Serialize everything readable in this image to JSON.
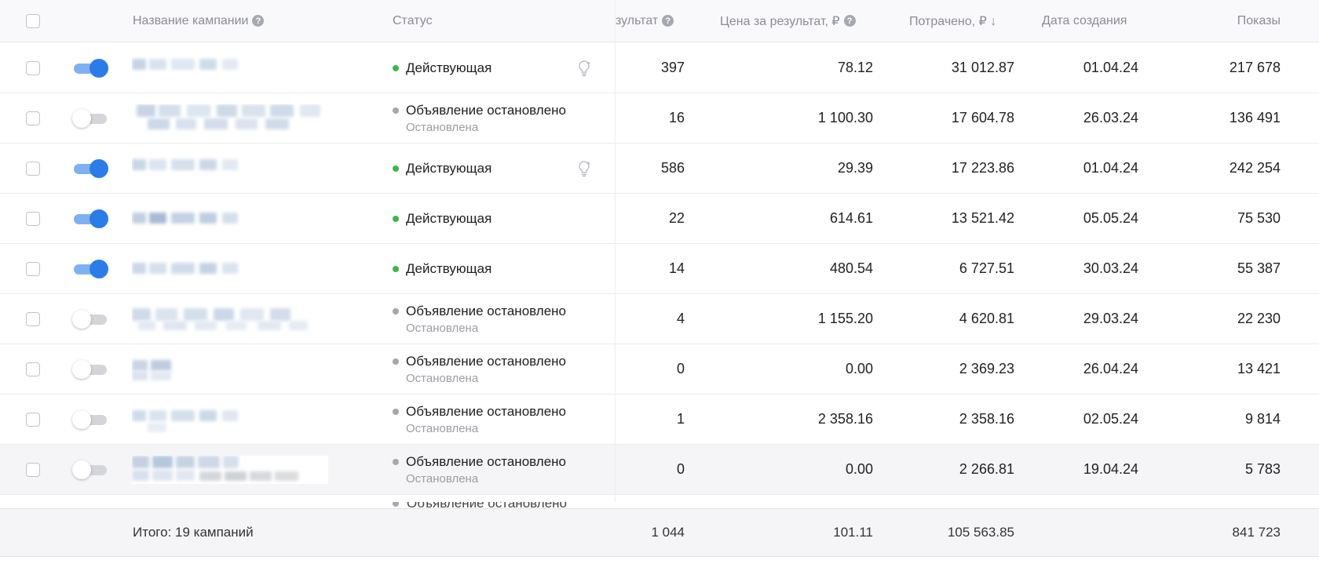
{
  "header": {
    "name_label": "Название кампании",
    "name_help": "?",
    "status_label": "Статус",
    "result_label": "зультат",
    "result_help": "?",
    "cpr_label": "Цена за результат, ₽",
    "cpr_help": "?",
    "spent_label": "Потрачено, ₽ ↓",
    "created_label": "Дата создания",
    "impressions_label": "Показы"
  },
  "rows": [
    {
      "on": true,
      "status": "Действующая",
      "status_color": "green",
      "sub": "",
      "bulb": true,
      "result": "397",
      "cpr": "78.12",
      "spent": "31 012.87",
      "created": "01.04.24",
      "impressions": "217 678"
    },
    {
      "on": false,
      "status": "Объявление остановлено",
      "status_color": "grey",
      "sub": "Остановлена",
      "bulb": false,
      "result": "16",
      "cpr": "1 100.30",
      "spent": "17 604.78",
      "created": "26.03.24",
      "impressions": "136 491"
    },
    {
      "on": true,
      "status": "Действующая",
      "status_color": "green",
      "sub": "",
      "bulb": true,
      "result": "586",
      "cpr": "29.39",
      "spent": "17 223.86",
      "created": "01.04.24",
      "impressions": "242 254"
    },
    {
      "on": true,
      "status": "Действующая",
      "status_color": "green",
      "sub": "",
      "bulb": false,
      "result": "22",
      "cpr": "614.61",
      "spent": "13 521.42",
      "created": "05.05.24",
      "impressions": "75 530"
    },
    {
      "on": true,
      "status": "Действующая",
      "status_color": "green",
      "sub": "",
      "bulb": false,
      "result": "14",
      "cpr": "480.54",
      "spent": "6 727.51",
      "created": "30.03.24",
      "impressions": "55 387"
    },
    {
      "on": false,
      "status": "Объявление остановлено",
      "status_color": "grey",
      "sub": "Остановлена",
      "bulb": false,
      "result": "4",
      "cpr": "1 155.20",
      "spent": "4 620.81",
      "created": "29.03.24",
      "impressions": "22 230"
    },
    {
      "on": false,
      "status": "Объявление остановлено",
      "status_color": "grey",
      "sub": "Остановлена",
      "bulb": false,
      "result": "0",
      "cpr": "0.00",
      "spent": "2 369.23",
      "created": "26.04.24",
      "impressions": "13 421"
    },
    {
      "on": false,
      "status": "Объявление остановлено",
      "status_color": "grey",
      "sub": "Остановлена",
      "bulb": false,
      "result": "1",
      "cpr": "2 358.16",
      "spent": "2 358.16",
      "created": "02.05.24",
      "impressions": "9 814"
    },
    {
      "on": false,
      "status": "Объявление остановлено",
      "status_color": "grey",
      "sub": "Остановлена",
      "bulb": false,
      "result": "0",
      "cpr": "0.00",
      "spent": "2 266.81",
      "created": "19.04.24",
      "impressions": "5 783",
      "highlight": true
    }
  ],
  "partial_row_status": "Объявление остановлено",
  "footer": {
    "total_label": "Итого: 19 кампаний",
    "result": "1 044",
    "cpr": "101.11",
    "spent": "105 563.85",
    "impressions": "841 723"
  },
  "colors": {
    "toggle_on": "#2c7ce8",
    "status_active": "#3db64a",
    "status_stopped": "#a4a7ad"
  }
}
